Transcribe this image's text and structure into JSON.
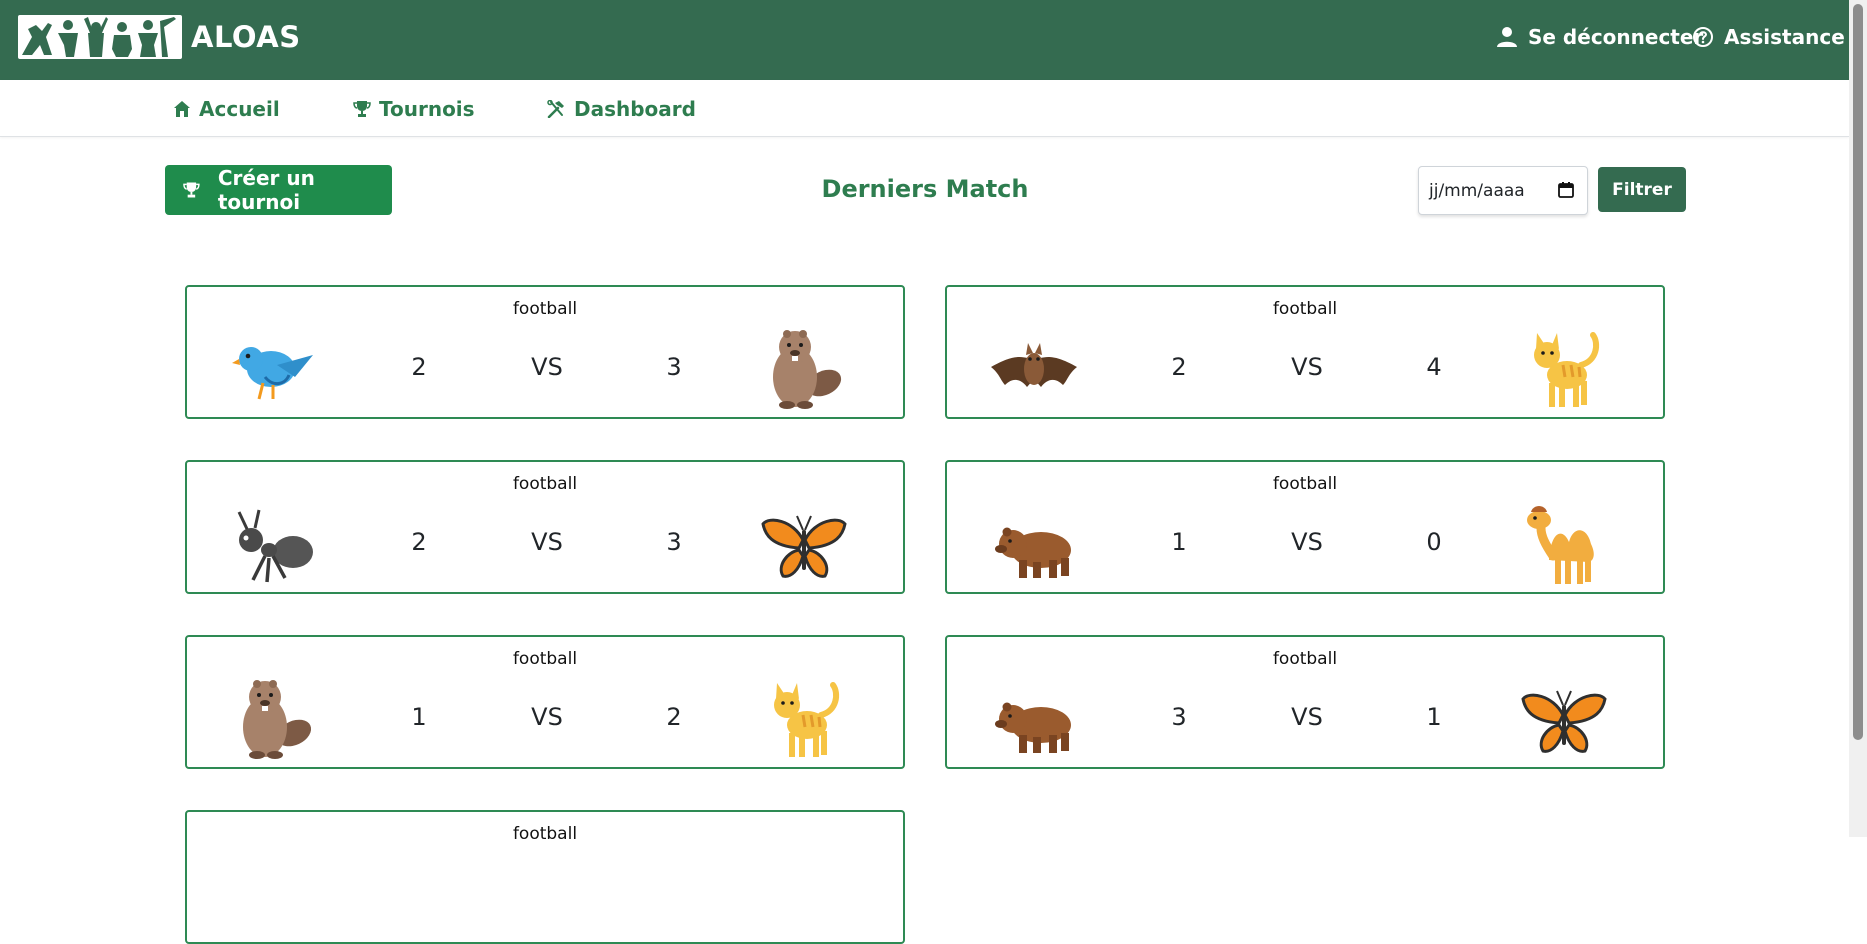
{
  "header": {
    "app_name": "ALOAS",
    "login_label": "Se déconnecter",
    "help_label": "Assistance"
  },
  "nav": {
    "items": [
      {
        "label": "Accueil",
        "icon": "home-icon"
      },
      {
        "label": "Tournois",
        "icon": "trophy-icon"
      },
      {
        "label": "Dashboard",
        "icon": "tools-icon"
      }
    ]
  },
  "toolbar": {
    "create_label": "Créer un tournoi",
    "heading": "Derniers Match",
    "date_placeholder": "jj/mm/aaaa",
    "filter_label": "Filtrer"
  },
  "matches": [
    {
      "sport": "football",
      "team_a": "bird",
      "score_a": "2",
      "vs": "VS",
      "score_b": "3",
      "team_b": "beaver"
    },
    {
      "sport": "football",
      "team_a": "bat",
      "score_a": "2",
      "vs": "VS",
      "score_b": "4",
      "team_b": "cat"
    },
    {
      "sport": "football",
      "team_a": "ant",
      "score_a": "2",
      "vs": "VS",
      "score_b": "3",
      "team_b": "butterfly"
    },
    {
      "sport": "football",
      "team_a": "bear",
      "score_a": "1",
      "vs": "VS",
      "score_b": "0",
      "team_b": "camel"
    },
    {
      "sport": "football",
      "team_a": "beaver",
      "score_a": "1",
      "vs": "VS",
      "score_b": "2",
      "team_b": "cat"
    },
    {
      "sport": "football",
      "team_a": "bear",
      "score_a": "3",
      "vs": "VS",
      "score_b": "1",
      "team_b": "butterfly"
    },
    {
      "sport": "football",
      "team_a": "",
      "score_a": "",
      "vs": "",
      "score_b": "",
      "team_b": ""
    }
  ],
  "colors": {
    "header_bg": "#346b50",
    "accent_green": "#1f8c4c",
    "card_border": "#2e8a54"
  }
}
